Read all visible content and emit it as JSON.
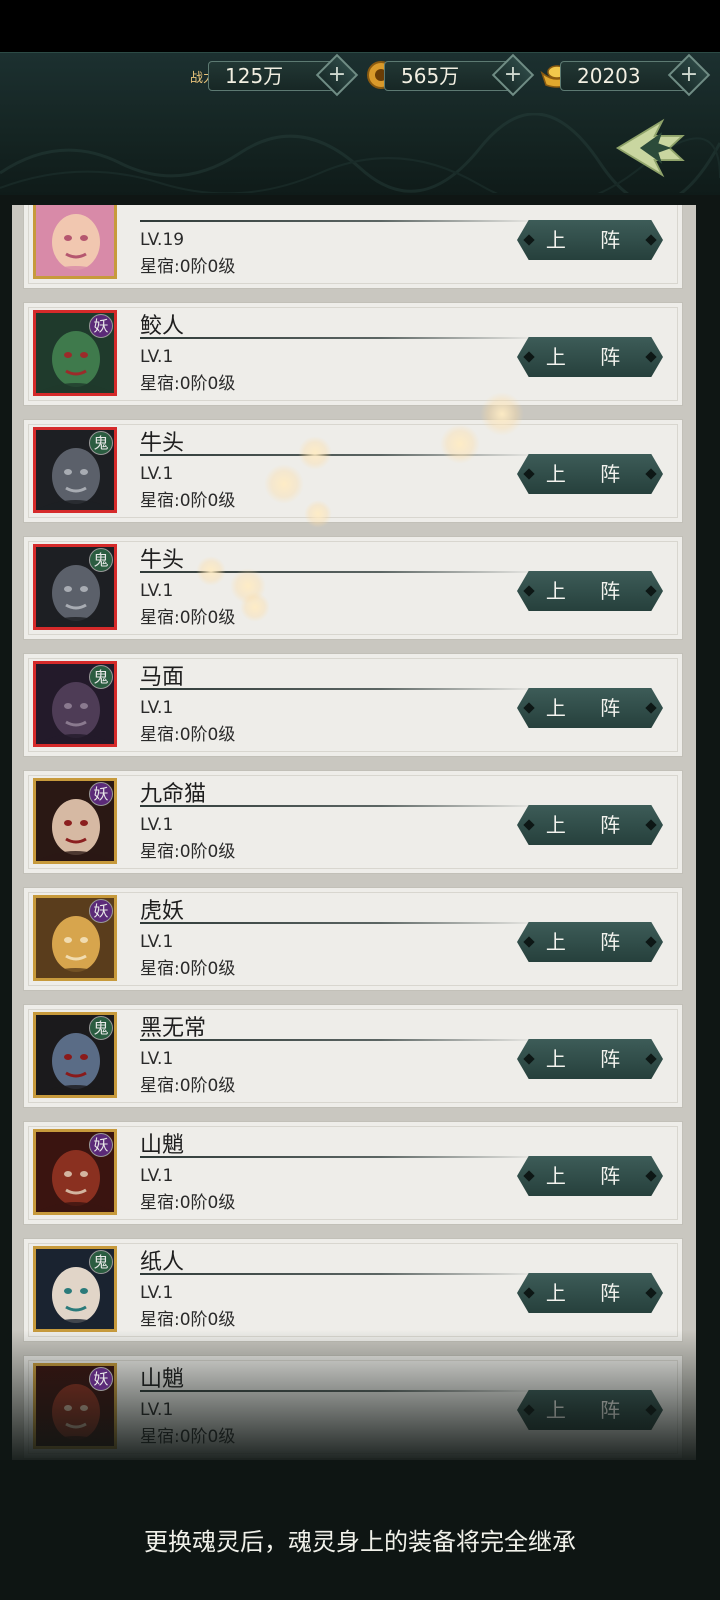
{
  "header": {
    "power": {
      "label": "战力",
      "value": "125万"
    },
    "coins": {
      "value": "565万"
    },
    "ingots": {
      "value": "20203"
    },
    "plus_symbol": "+"
  },
  "list": {
    "rows": [
      {
        "name": "",
        "level": "LV.19",
        "star": "星宿:0阶0级",
        "type": "",
        "frame": "gold",
        "button": "上 阵"
      },
      {
        "name": "鲛人",
        "level": "LV.1",
        "star": "星宿:0阶0级",
        "type": "妖",
        "frame": "red",
        "button": "上 阵"
      },
      {
        "name": "牛头",
        "level": "LV.1",
        "star": "星宿:0阶0级",
        "type": "鬼",
        "frame": "red",
        "button": "上 阵"
      },
      {
        "name": "牛头",
        "level": "LV.1",
        "star": "星宿:0阶0级",
        "type": "鬼",
        "frame": "red",
        "button": "上 阵"
      },
      {
        "name": "马面",
        "level": "LV.1",
        "star": "星宿:0阶0级",
        "type": "鬼",
        "frame": "red",
        "button": "上 阵"
      },
      {
        "name": "九命猫",
        "level": "LV.1",
        "star": "星宿:0阶0级",
        "type": "妖",
        "frame": "gold",
        "button": "上 阵"
      },
      {
        "name": "虎妖",
        "level": "LV.1",
        "star": "星宿:0阶0级",
        "type": "妖",
        "frame": "gold",
        "button": "上 阵"
      },
      {
        "name": "黑无常",
        "level": "LV.1",
        "star": "星宿:0阶0级",
        "type": "鬼",
        "frame": "gold",
        "button": "上 阵"
      },
      {
        "name": "山魈",
        "level": "LV.1",
        "star": "星宿:0阶0级",
        "type": "妖",
        "frame": "gold",
        "button": "上 阵"
      },
      {
        "name": "纸人",
        "level": "LV.1",
        "star": "星宿:0阶0级",
        "type": "鬼",
        "frame": "gold",
        "button": "上 阵"
      },
      {
        "name": "山魈",
        "level": "LV.1",
        "star": "星宿:0阶0级",
        "type": "妖",
        "frame": "gold",
        "button": "上 阵"
      }
    ]
  },
  "footer": {
    "tip": "更换魂灵后，魂灵身上的装备将完全继承"
  },
  "colors": {
    "header_bg": "#172826",
    "panel_bg": "#c9c7c0",
    "button": "#2f4b47",
    "frame_red": "#d52a2a",
    "frame_gold": "#c79a3c"
  }
}
